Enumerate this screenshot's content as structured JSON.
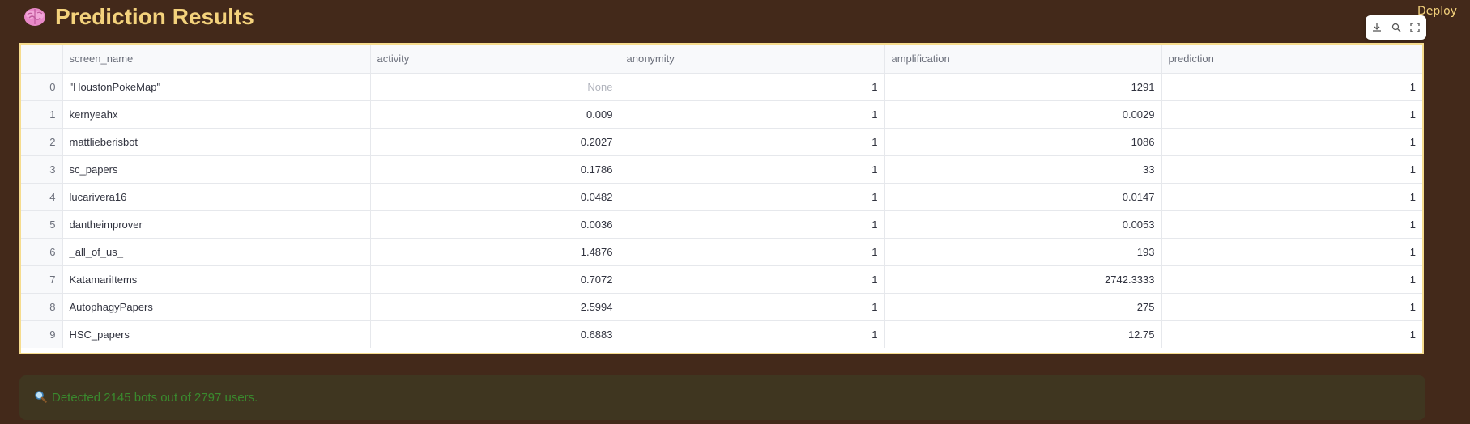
{
  "header": {
    "title": "Prediction Results",
    "deploy_label": "Deploy"
  },
  "toolbar": {
    "icons": [
      "download-icon",
      "search-icon",
      "fullscreen-icon"
    ]
  },
  "table": {
    "columns": [
      "",
      "screen_name",
      "activity",
      "anonymity",
      "amplification",
      "prediction"
    ],
    "rows": [
      {
        "index": "0",
        "screen_name": "\"HoustonPokeMap\"",
        "activity": "None",
        "anonymity": "1",
        "amplification": "1291",
        "prediction": "1"
      },
      {
        "index": "1",
        "screen_name": "kernyeahx",
        "activity": "0.009",
        "anonymity": "1",
        "amplification": "0.0029",
        "prediction": "1"
      },
      {
        "index": "2",
        "screen_name": "mattlieberisbot",
        "activity": "0.2027",
        "anonymity": "1",
        "amplification": "1086",
        "prediction": "1"
      },
      {
        "index": "3",
        "screen_name": "sc_papers",
        "activity": "0.1786",
        "anonymity": "1",
        "amplification": "33",
        "prediction": "1"
      },
      {
        "index": "4",
        "screen_name": "lucarivera16",
        "activity": "0.0482",
        "anonymity": "1",
        "amplification": "0.0147",
        "prediction": "1"
      },
      {
        "index": "5",
        "screen_name": "dantheimprover",
        "activity": "0.0036",
        "anonymity": "1",
        "amplification": "0.0053",
        "prediction": "1"
      },
      {
        "index": "6",
        "screen_name": "_all_of_us_",
        "activity": "1.4876",
        "anonymity": "1",
        "amplification": "193",
        "prediction": "1"
      },
      {
        "index": "7",
        "screen_name": "KatamariItems",
        "activity": "0.7072",
        "anonymity": "1",
        "amplification": "2742.3333",
        "prediction": "1"
      },
      {
        "index": "8",
        "screen_name": "AutophagyPapers",
        "activity": "2.5994",
        "anonymity": "1",
        "amplification": "275",
        "prediction": "1"
      },
      {
        "index": "9",
        "screen_name": "HSC_papers",
        "activity": "0.6883",
        "anonymity": "1",
        "amplification": "12.75",
        "prediction": "1"
      }
    ]
  },
  "alert": {
    "text": "Detected 2145 bots out of 2797 users."
  },
  "colors": {
    "background": "#43291a",
    "accent": "#f4d27c",
    "alert_bg": "#3f3620",
    "alert_text": "#3a8a2e"
  }
}
